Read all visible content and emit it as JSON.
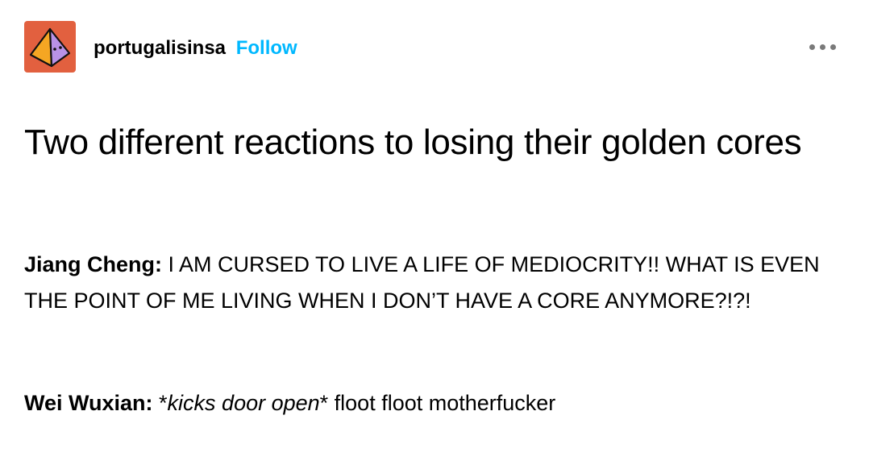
{
  "post": {
    "avatar_icon": "pyramid-icon",
    "avatar_color": "#e2603f",
    "blog_name": "portugalisinsa",
    "follow_label": "Follow",
    "follow_color": "#00b8ff",
    "menu_icon": "more-horizontal-icon",
    "title": "Two different reactions to losing their golden cores",
    "paragraphs": [
      {
        "speaker": "Jiang Cheng",
        "colon": ":",
        "text": " I AM CURSED TO LIVE A LIFE OF MEDIOCRITY!! WHAT IS EVEN THE POINT OF ME LIVING WHEN I DON’T HAVE A CORE ANYMORE?!?!"
      },
      {
        "speaker": "Wei Wuxian",
        "colon": ":",
        "pre": " *",
        "action": "kicks door open",
        "post": "* floot floot motherfucker"
      }
    ]
  }
}
